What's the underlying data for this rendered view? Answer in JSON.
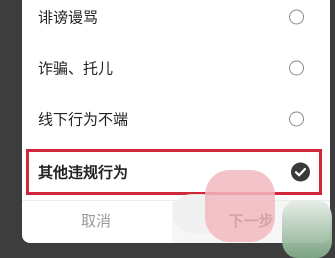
{
  "options": [
    {
      "label": "诽谤谩骂",
      "selected": false
    },
    {
      "label": "诈骗、托儿",
      "selected": false
    },
    {
      "label": "线下行为不端",
      "selected": false
    },
    {
      "label": "其他违规行为",
      "selected": true
    }
  ],
  "footer": {
    "cancel_label": "取消",
    "next_label": "下一步"
  },
  "colors": {
    "highlight_border": "#d0283a",
    "checked_radio": "#3a3a3a",
    "overlay": "#3d3d3d"
  },
  "icons": {
    "radio_unchecked": "radio-unchecked-icon",
    "radio_checked": "radio-checked-icon"
  }
}
